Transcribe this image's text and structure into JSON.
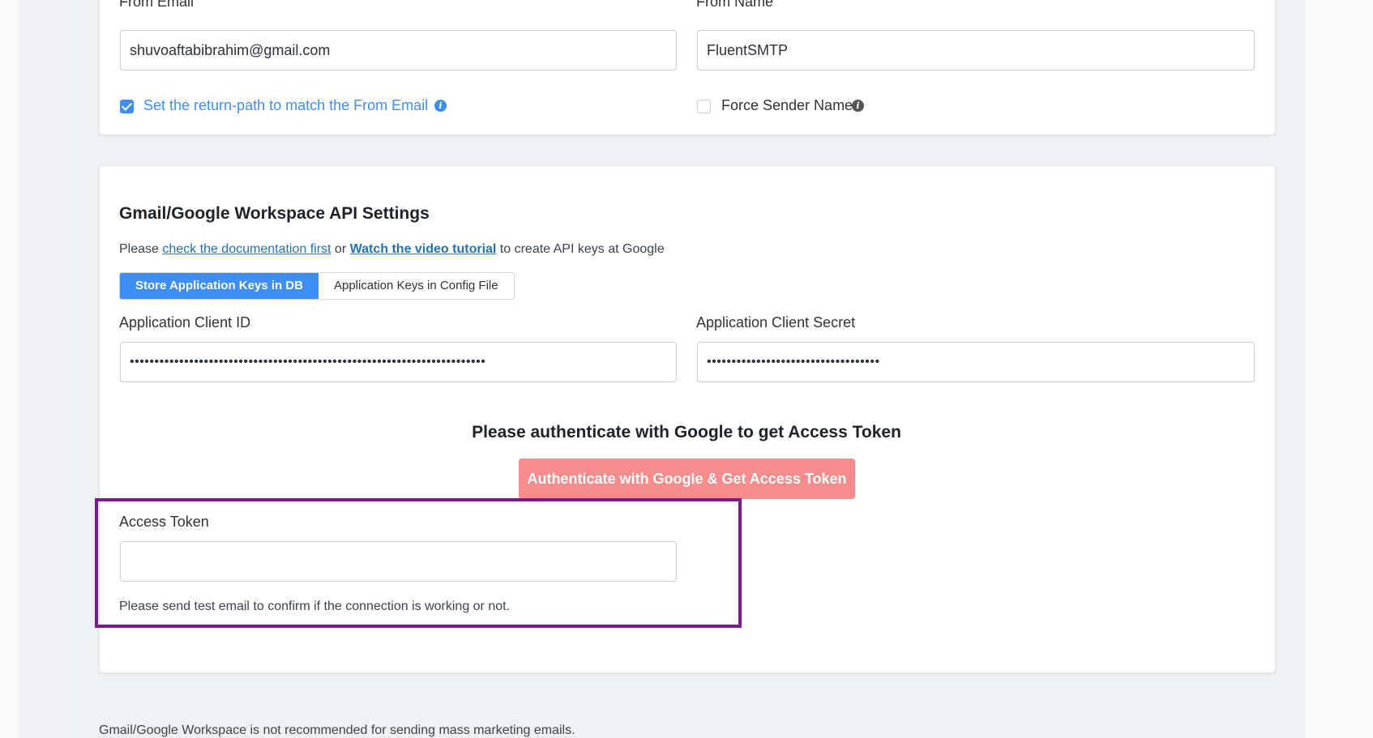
{
  "sender": {
    "from_email_label": "From Email",
    "from_email_value": "shuvoaftabibrahim@gmail.com",
    "from_name_label": "From Name",
    "from_name_value": "FluentSMTP",
    "return_path_label": "Set the return-path to match the From Email",
    "return_path_checked": true,
    "force_sender_label": "Force Sender Name",
    "force_sender_checked": false
  },
  "gmail": {
    "heading": "Gmail/Google Workspace API Settings",
    "intro_prefix": "Please ",
    "doc_link": "check the documentation first",
    "intro_mid": " or ",
    "video_link": "Watch the video tutorial",
    "intro_suffix": " to create API keys at Google",
    "tabs": [
      {
        "label": "Store Application Keys in DB",
        "active": true
      },
      {
        "label": "Application Keys in Config File",
        "active": false
      }
    ],
    "client_id_label": "Application Client ID",
    "client_id_value": "••••••••••••••••••••••••••••••••••••••••••••••••••••••••••••••••••••••••",
    "client_secret_label": "Application Client Secret",
    "client_secret_value": "•••••••••••••••••••••••••••••••••••",
    "auth_title": "Please authenticate with Google to get Access Token",
    "auth_button": "Authenticate with Google & Get Access Token",
    "access_token_label": "Access Token",
    "access_token_value": "",
    "access_token_help": "Please send test email to confirm if the connection is working or not."
  },
  "footer_note": "Gmail/Google Workspace is not recommended for sending mass marketing emails.",
  "colors": {
    "accent": "#3e8ef7",
    "auth_button": "#f78c8c",
    "highlight_border": "#7b1b8c",
    "link": "#2271b1"
  }
}
